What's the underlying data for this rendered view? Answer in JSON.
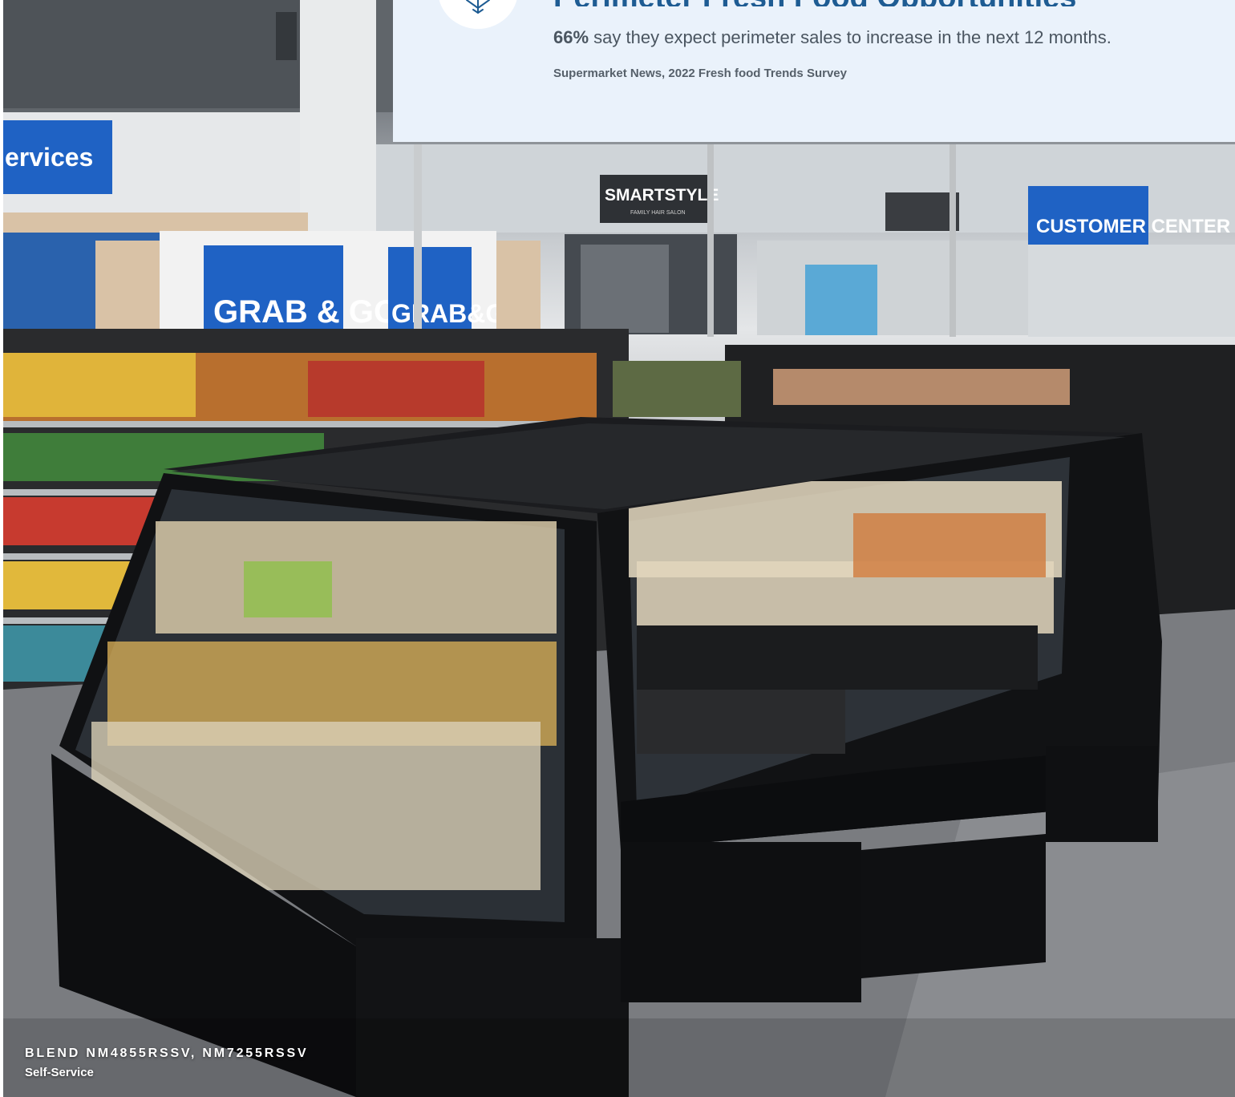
{
  "stat": {
    "heading": "Perimeter Fresh Food Opportunities",
    "highlight": "66%",
    "text": " say they expect perimeter sales to increase in the next 12 months.",
    "source": "Supermarket News, 2022 Fresh food Trends Survey",
    "icon": "snowflake-icon"
  },
  "photo": {
    "signs": {
      "services": "ervices",
      "grab_go_left": "GRAB & GO",
      "grab_go_right": "GRAB&GO",
      "salon": "SMARTSTYLE",
      "salon_sub": "FAMILY HAIR SALON",
      "customer_center": "CUSTOMER CENTER"
    }
  },
  "caption": {
    "model": "BLEND NM4855RSSV, NM7255RSSV",
    "type": "Self-Service"
  },
  "colors": {
    "card_bg": "#eaf2fb",
    "accent": "#1e5c93",
    "sign_blue": "#1f62c4"
  }
}
